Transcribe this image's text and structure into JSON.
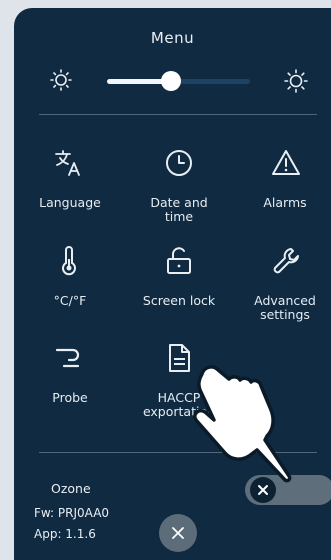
{
  "menu": {
    "title": "Menu"
  },
  "brightness": {
    "level_percent": 45,
    "low_icon": "sun-small-icon",
    "high_icon": "sun-large-icon"
  },
  "tiles": [
    {
      "label": "Language",
      "icon": "translate-icon"
    },
    {
      "label": "Date and\ntime",
      "icon": "clock-icon"
    },
    {
      "label": "Alarms",
      "icon": "warning-icon"
    },
    {
      "label": "°C/°F",
      "icon": "thermometer-icon"
    },
    {
      "label": "Screen lock",
      "icon": "unlock-icon"
    },
    {
      "label": "Advanced\nsettings",
      "icon": "wrench-icon"
    },
    {
      "label": "Probe",
      "icon": "probe-icon"
    },
    {
      "label": "HACCP\nexportation",
      "icon": "document-icon"
    }
  ],
  "ozone": {
    "label": "Ozone",
    "enabled": false,
    "knob_icon": "close-icon"
  },
  "footer": {
    "firmware": "Fw: PRJ0AA0",
    "app_version": "App: 1.1.6",
    "close_icon": "close-icon"
  },
  "overlay": {
    "icon": "pointing-hand-icon"
  },
  "colors": {
    "panel": "#0f2a41",
    "frame": "#dfe4ea",
    "text": "#e9eef3",
    "toggle_off": "#5e6f7b"
  }
}
